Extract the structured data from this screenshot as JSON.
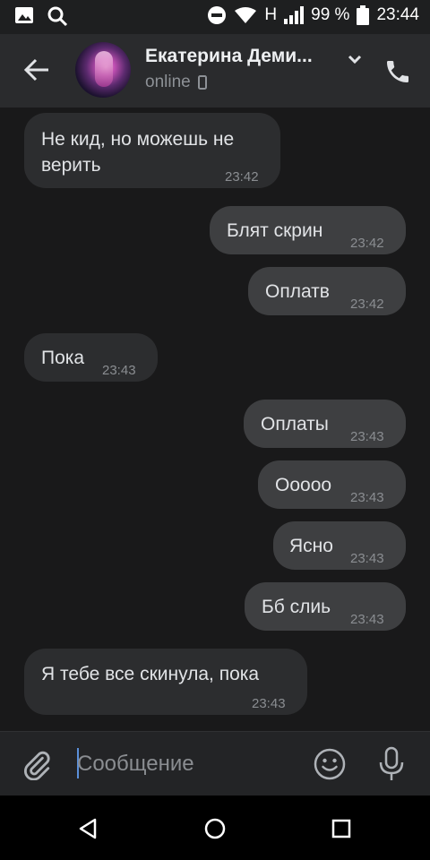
{
  "status_bar": {
    "battery_percent": "99 %",
    "time": "23:44",
    "network": "H"
  },
  "header": {
    "contact_name": "Екатерина Деми...",
    "presence": "online"
  },
  "messages": [
    {
      "direction": "in",
      "lines": [
        "Не кид, но можешь не",
        "верить"
      ],
      "time": "23:42"
    },
    {
      "direction": "out",
      "text": "Блят скрин",
      "time": "23:42"
    },
    {
      "direction": "out",
      "text": "Оплатв",
      "time": "23:42"
    },
    {
      "direction": "in",
      "text": "Пока",
      "time": "23:43"
    },
    {
      "direction": "out",
      "text": "Оплаты",
      "time": "23:43"
    },
    {
      "direction": "out",
      "text": "Ооооо",
      "time": "23:43"
    },
    {
      "direction": "out",
      "text": "Ясно",
      "time": "23:43"
    },
    {
      "direction": "out",
      "text": "Бб слиь",
      "time": "23:43"
    },
    {
      "direction": "in",
      "text": "Я тебе все скинула, пока",
      "time": "23:43"
    }
  ],
  "composer": {
    "placeholder": "Сообщение"
  },
  "colors": {
    "background": "#19191a",
    "incoming_bubble": "#2c2d2f",
    "outgoing_bubble": "#3e3f41",
    "caret": "#5a8fd9"
  },
  "icons": [
    "image-icon",
    "search-icon",
    "dnd-icon",
    "wifi-icon",
    "signal-icon",
    "battery-icon",
    "back-arrow-icon",
    "chevron-down-icon",
    "phone-icon",
    "mobile-device-icon",
    "paperclip-icon",
    "emoji-icon",
    "microphone-icon",
    "nav-back-icon",
    "nav-home-icon",
    "nav-recents-icon"
  ]
}
